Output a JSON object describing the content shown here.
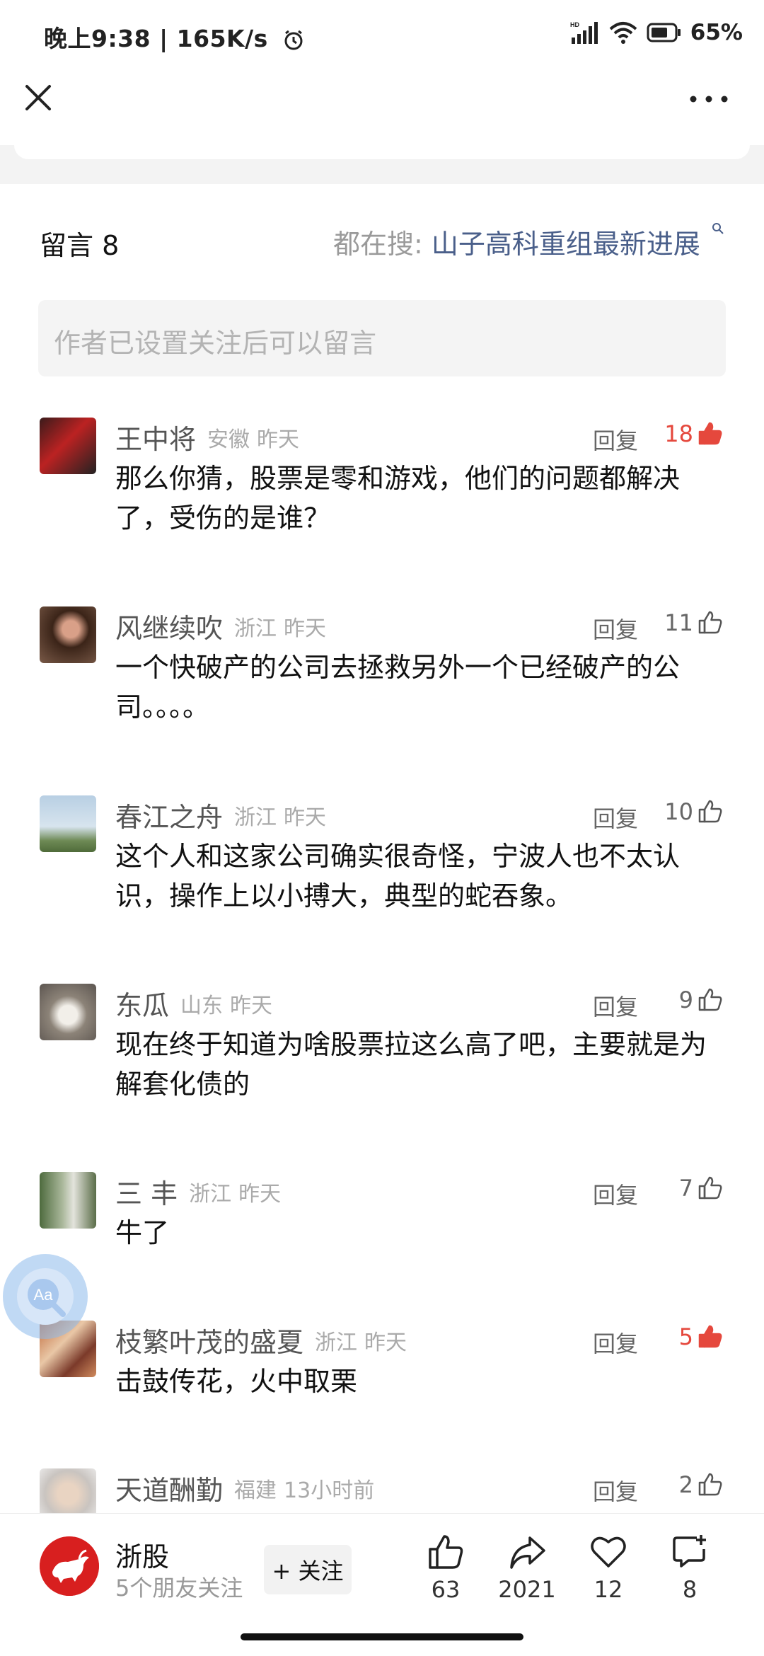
{
  "status_bar": {
    "time": "晚上9:38",
    "speed": "165K/s",
    "battery": "65%"
  },
  "comments_section": {
    "title": "留言 8",
    "search_prefix": "都在搜:",
    "search_term": "山子高科重组最新进展",
    "input_placeholder": "作者已设置关注后可以留言",
    "reply_label": "回复",
    "items": [
      {
        "name": "王中将",
        "location": "安徽",
        "time": "昨天",
        "likes": "18",
        "liked": true,
        "text": "那么你猜，股票是零和游戏，他们的问题都解决了，受伤的是谁？"
      },
      {
        "name": "风继续吹",
        "location": "浙江",
        "time": "昨天",
        "likes": "11",
        "liked": false,
        "text": "一个快破产的公司去拯救另外一个已经破产的公司。。。。"
      },
      {
        "name": "春江之舟",
        "location": "浙江",
        "time": "昨天",
        "likes": "10",
        "liked": false,
        "text": "这个人和这家公司确实很奇怪，宁波人也不太认识，操作上以小搏大，典型的蛇吞象。"
      },
      {
        "name": "东瓜",
        "location": "山东",
        "time": "昨天",
        "likes": "9",
        "liked": false,
        "text": "现在终于知道为啥股票拉这么高了吧，主要就是为解套化债的"
      },
      {
        "name": "三 丰",
        "location": "浙江",
        "time": "昨天",
        "likes": "7",
        "liked": false,
        "text": "牛了"
      },
      {
        "name": "枝繁叶茂的盛夏",
        "location": "浙江",
        "time": "昨天",
        "likes": "5",
        "liked": true,
        "text": "击鼓传花，火中取栗"
      },
      {
        "name": "天道酬勤",
        "location": "福建",
        "time": "13小时前",
        "likes": "2",
        "liked": false,
        "text": ""
      }
    ]
  },
  "float_button": {
    "label": "Aa"
  },
  "bottom_bar": {
    "account_name": "浙股",
    "account_sub": "5个朋友关注",
    "follow_label": "+ 关注",
    "like_count": "63",
    "share_count": "2021",
    "favorite_count": "12",
    "comment_count": "8"
  },
  "colors": {
    "accent_red": "#e5483d",
    "link_blue": "#4a5f8a",
    "brand_red": "#d81f1f"
  }
}
